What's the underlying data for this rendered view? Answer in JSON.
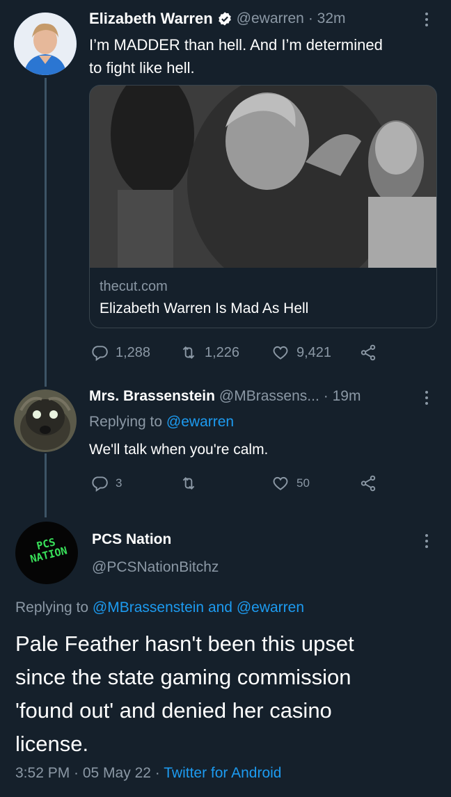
{
  "tweet1": {
    "author_name": "Elizabeth Warren",
    "handle": "@ewarren",
    "time": "· 32m",
    "text_line1": "I’m MADDER than hell. And I’m determined",
    "text_line2": "to fight like hell.",
    "card_domain": "thecut.com",
    "card_title": "Elizabeth Warren Is Mad As Hell",
    "replies": "1,288",
    "retweets": "1,226",
    "likes": "9,421"
  },
  "tweet2": {
    "author_name": "Mrs. Brassenstein",
    "handle": "@MBrassens...",
    "time": "· 19m",
    "replying_prefix": "Replying to",
    "replying_to": "@ewarren",
    "text": "We'll talk when you're calm.",
    "replies": "3",
    "likes": "50"
  },
  "tweet3": {
    "author_name": "PCS Nation",
    "handle": "@PCSNationBitchz",
    "avatar_text_top": "PCS",
    "avatar_text_bottom": "NATION",
    "replying_prefix": "Replying to",
    "replying_to": "@MBrassenstein and @ewarren",
    "text_lines": [
      "Pale Feather hasn't been this upset",
      "since the state gaming commission",
      "'found out' and denied her casino",
      "license."
    ],
    "timestamp": "3:52 PM · 05 May 22 ·",
    "source": "Twitter for Android"
  },
  "icons": {
    "verified": "verified-badge-icon",
    "reply": "reply-icon",
    "retweet": "retweet-icon",
    "like": "heart-icon",
    "share": "share-icon",
    "more": "more-vertical-icon"
  },
  "colors": {
    "background": "#15202b",
    "accent": "#1d9bf0",
    "muted": "#8b98a5",
    "thread_line": "#3d5466"
  }
}
